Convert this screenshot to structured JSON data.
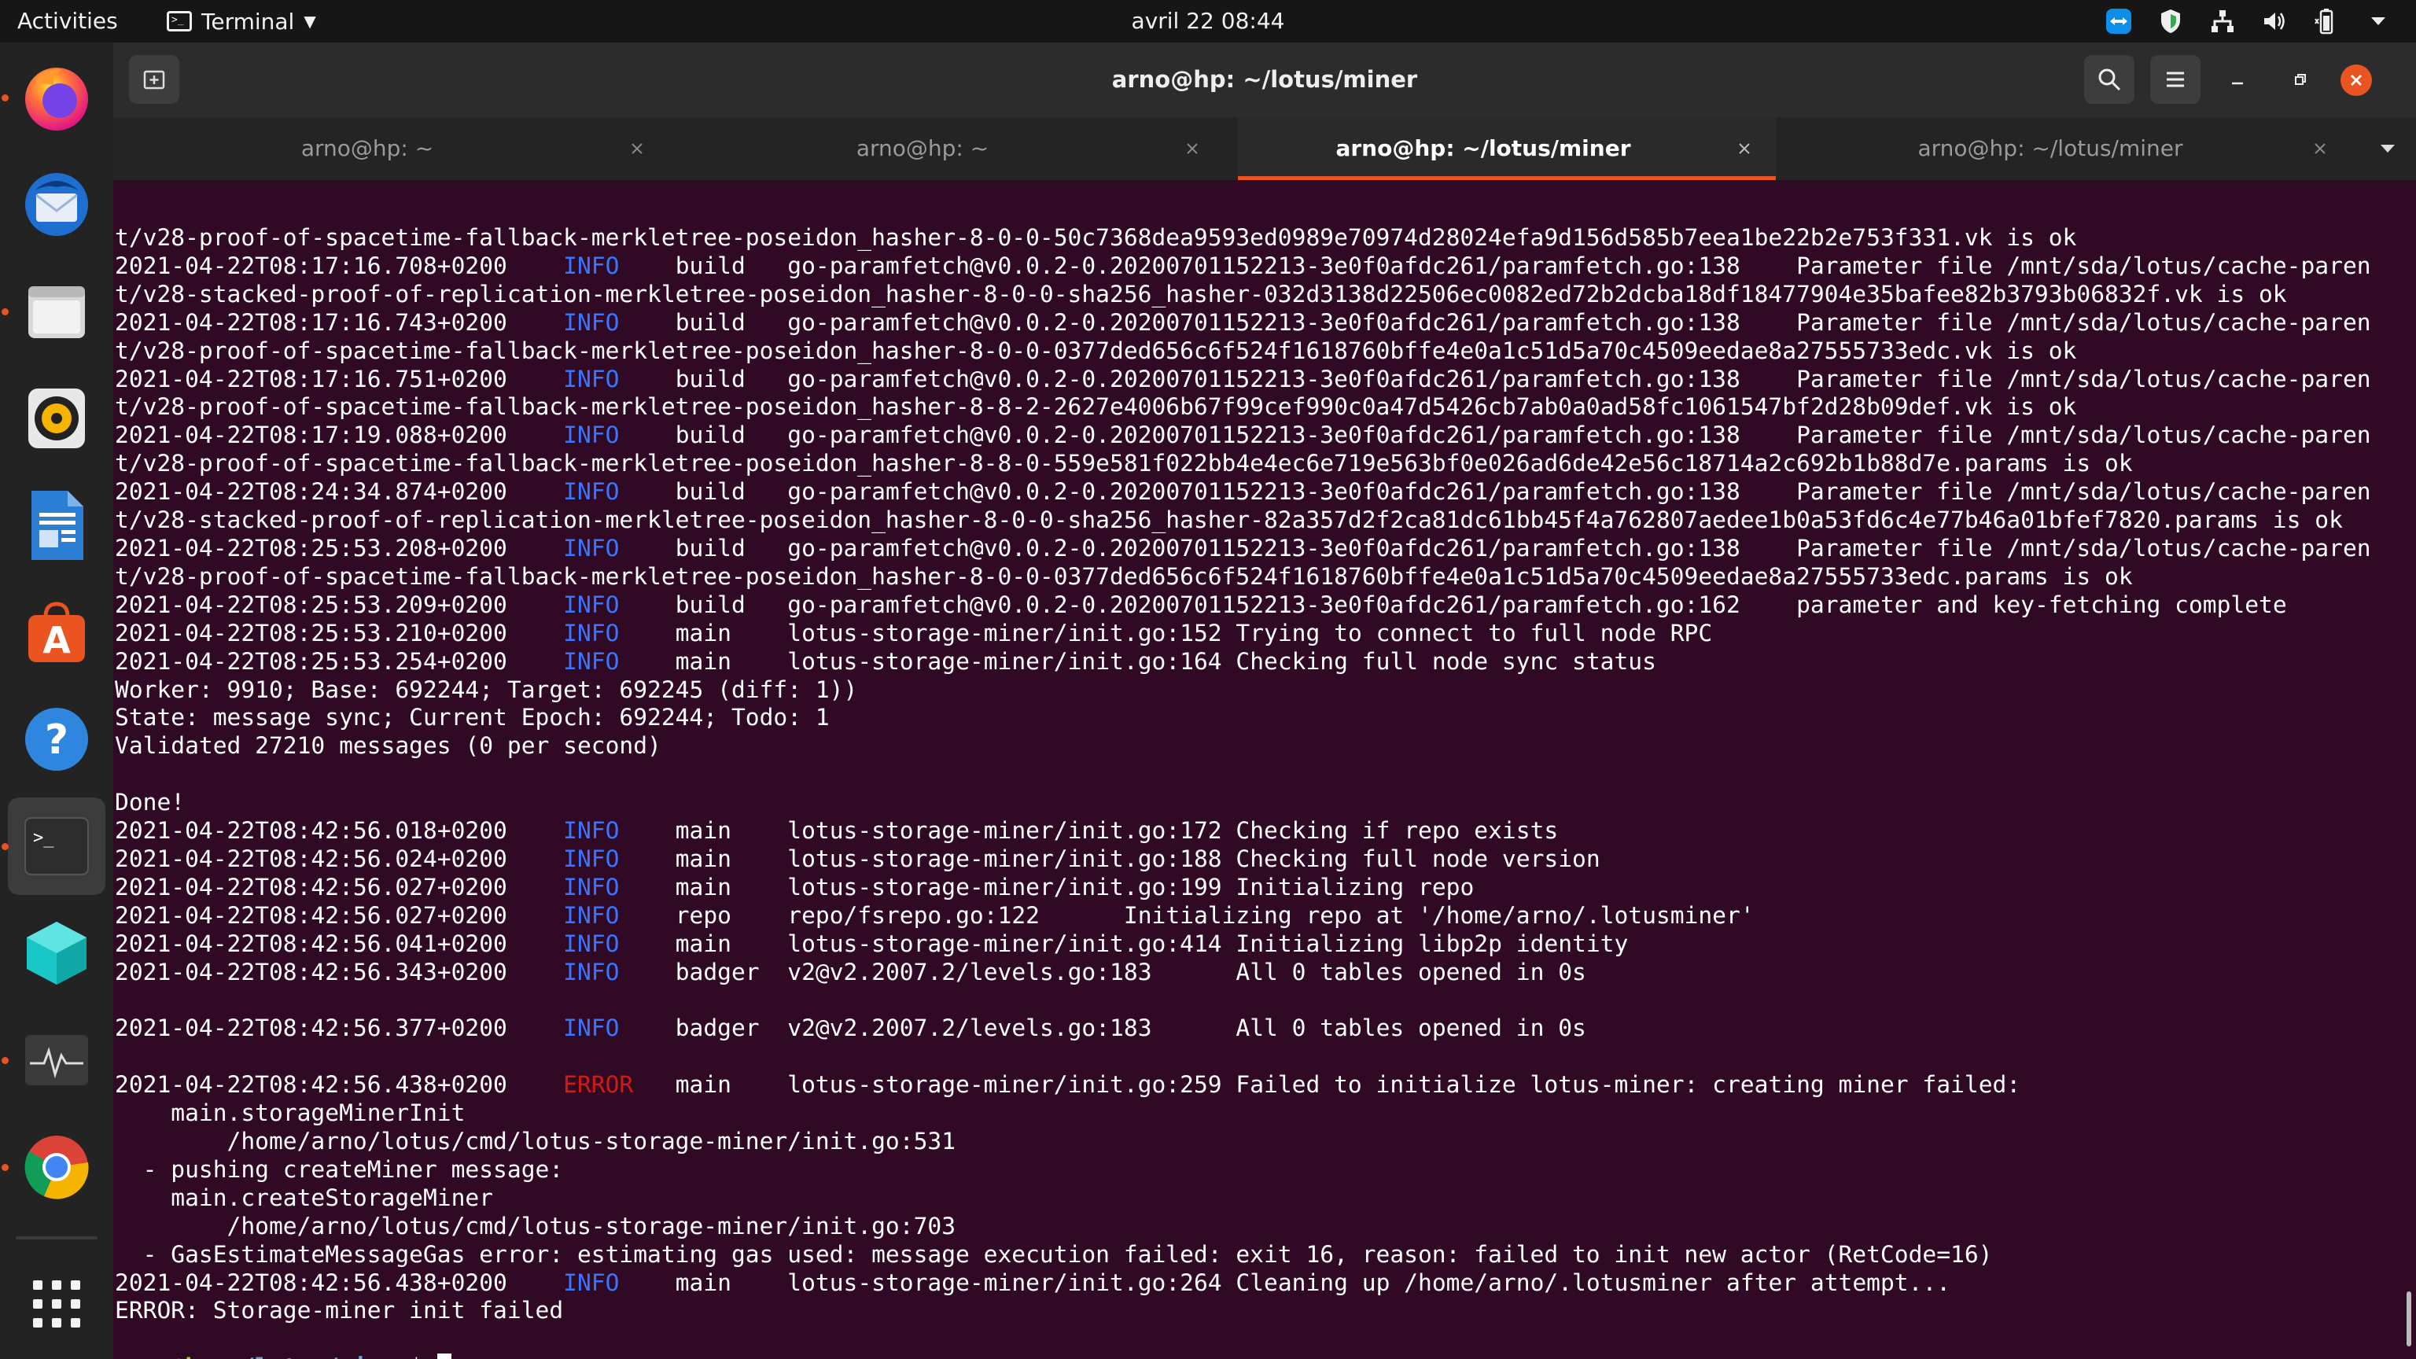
{
  "topbar": {
    "activities": "Activities",
    "app_name": "Terminal",
    "clock": "avril 22  08:44"
  },
  "dock": {
    "apps": [
      {
        "name": "firefox",
        "running": true
      },
      {
        "name": "thunderbird",
        "running": false
      },
      {
        "name": "files",
        "running": true
      },
      {
        "name": "rhythmbox",
        "running": false
      },
      {
        "name": "libreoffice-writer",
        "running": false
      },
      {
        "name": "ubuntu-software",
        "running": false
      },
      {
        "name": "help",
        "running": false
      },
      {
        "name": "terminal",
        "running": true,
        "active": true
      },
      {
        "name": "3d-cube-app",
        "running": false
      },
      {
        "name": "system-monitor",
        "running": true
      },
      {
        "name": "chrome",
        "running": true
      }
    ]
  },
  "window": {
    "title": "arno@hp: ~/lotus/miner",
    "tabs": [
      {
        "label": "arno@hp: ~",
        "active": false
      },
      {
        "label": "arno@hp: ~",
        "active": false
      },
      {
        "label": "arno@hp: ~/lotus/miner",
        "active": true
      },
      {
        "label": "arno@hp: ~/lotus/miner",
        "active": false
      }
    ]
  },
  "colors": {
    "accent": "#e95420",
    "info": "#3a74ff",
    "error": "#d11a14",
    "prompt_user": "#8ae234",
    "prompt_path": "#729fcf",
    "background": "#300a24"
  },
  "terminal": {
    "lines": [
      {
        "text": "t/v28-proof-of-spacetime-fallback-merkletree-poseidon_hasher-8-0-0-50c7368dea9593ed0989e70974d28024efa9d156d585b7eea1be22b2e753f331.vk is ok"
      },
      {
        "ts": "2021-04-22T08:17:16.708+0200",
        "level": "INFO",
        "module": "build ",
        "msg": "go-paramfetch@v0.0.2-0.20200701152213-3e0f0afdc261/paramfetch.go:138    Parameter file /mnt/sda/lotus/cache-paren"
      },
      {
        "text": "t/v28-stacked-proof-of-replication-merkletree-poseidon_hasher-8-0-0-sha256_hasher-032d3138d22506ec0082ed72b2dcba18df18477904e35bafee82b3793b06832f.vk is ok"
      },
      {
        "ts": "2021-04-22T08:17:16.743+0200",
        "level": "INFO",
        "module": "build ",
        "msg": "go-paramfetch@v0.0.2-0.20200701152213-3e0f0afdc261/paramfetch.go:138    Parameter file /mnt/sda/lotus/cache-paren"
      },
      {
        "text": "t/v28-proof-of-spacetime-fallback-merkletree-poseidon_hasher-8-0-0-0377ded656c6f524f1618760bffe4e0a1c51d5a70c4509eedae8a27555733edc.vk is ok"
      },
      {
        "ts": "2021-04-22T08:17:16.751+0200",
        "level": "INFO",
        "module": "build ",
        "msg": "go-paramfetch@v0.0.2-0.20200701152213-3e0f0afdc261/paramfetch.go:138    Parameter file /mnt/sda/lotus/cache-paren"
      },
      {
        "text": "t/v28-proof-of-spacetime-fallback-merkletree-poseidon_hasher-8-8-2-2627e4006b67f99cef990c0a47d5426cb7ab0a0ad58fc1061547bf2d28b09def.vk is ok"
      },
      {
        "ts": "2021-04-22T08:17:19.088+0200",
        "level": "INFO",
        "module": "build ",
        "msg": "go-paramfetch@v0.0.2-0.20200701152213-3e0f0afdc261/paramfetch.go:138    Parameter file /mnt/sda/lotus/cache-paren"
      },
      {
        "text": "t/v28-proof-of-spacetime-fallback-merkletree-poseidon_hasher-8-8-0-559e581f022bb4e4ec6e719e563bf0e026ad6de42e56c18714a2c692b1b88d7e.params is ok"
      },
      {
        "ts": "2021-04-22T08:24:34.874+0200",
        "level": "INFO",
        "module": "build ",
        "msg": "go-paramfetch@v0.0.2-0.20200701152213-3e0f0afdc261/paramfetch.go:138    Parameter file /mnt/sda/lotus/cache-paren"
      },
      {
        "text": "t/v28-stacked-proof-of-replication-merkletree-poseidon_hasher-8-0-0-sha256_hasher-82a357d2f2ca81dc61bb45f4a762807aedee1b0a53fd6c4e77b46a01bfef7820.params is ok"
      },
      {
        "ts": "2021-04-22T08:25:53.208+0200",
        "level": "INFO",
        "module": "build ",
        "msg": "go-paramfetch@v0.0.2-0.20200701152213-3e0f0afdc261/paramfetch.go:138    Parameter file /mnt/sda/lotus/cache-paren"
      },
      {
        "text": "t/v28-proof-of-spacetime-fallback-merkletree-poseidon_hasher-8-0-0-0377ded656c6f524f1618760bffe4e0a1c51d5a70c4509eedae8a27555733edc.params is ok"
      },
      {
        "ts": "2021-04-22T08:25:53.209+0200",
        "level": "INFO",
        "module": "build ",
        "msg": "go-paramfetch@v0.0.2-0.20200701152213-3e0f0afdc261/paramfetch.go:162    parameter and key-fetching complete"
      },
      {
        "ts": "2021-04-22T08:25:53.210+0200",
        "level": "INFO",
        "module": "main  ",
        "msg": "lotus-storage-miner/init.go:152 Trying to connect to full node RPC"
      },
      {
        "ts": "2021-04-22T08:25:53.254+0200",
        "level": "INFO",
        "module": "main  ",
        "msg": "lotus-storage-miner/init.go:164 Checking full node sync status"
      },
      {
        "text": "Worker: 9910; Base: 692244; Target: 692245 (diff: 1))"
      },
      {
        "text": "State: message sync; Current Epoch: 692244; Todo: 1"
      },
      {
        "text": "Validated 27210 messages (0 per second)"
      },
      {
        "text": ""
      },
      {
        "text": "Done!"
      },
      {
        "ts": "2021-04-22T08:42:56.018+0200",
        "level": "INFO",
        "module": "main  ",
        "msg": "lotus-storage-miner/init.go:172 Checking if repo exists"
      },
      {
        "ts": "2021-04-22T08:42:56.024+0200",
        "level": "INFO",
        "module": "main  ",
        "msg": "lotus-storage-miner/init.go:188 Checking full node version"
      },
      {
        "ts": "2021-04-22T08:42:56.027+0200",
        "level": "INFO",
        "module": "main  ",
        "msg": "lotus-storage-miner/init.go:199 Initializing repo"
      },
      {
        "ts": "2021-04-22T08:42:56.027+0200",
        "level": "INFO",
        "module": "repo  ",
        "msg": "repo/fsrepo.go:122      Initializing repo at '/home/arno/.lotusminer'"
      },
      {
        "ts": "2021-04-22T08:42:56.041+0200",
        "level": "INFO",
        "module": "main  ",
        "msg": "lotus-storage-miner/init.go:414 Initializing libp2p identity"
      },
      {
        "ts": "2021-04-22T08:42:56.343+0200",
        "level": "INFO",
        "module": "badger",
        "msg": "v2@v2.2007.2/levels.go:183      All 0 tables opened in 0s"
      },
      {
        "text": ""
      },
      {
        "ts": "2021-04-22T08:42:56.377+0200",
        "level": "INFO",
        "module": "badger",
        "msg": "v2@v2.2007.2/levels.go:183      All 0 tables opened in 0s"
      },
      {
        "text": ""
      },
      {
        "ts": "2021-04-22T08:42:56.438+0200",
        "level": "ERROR",
        "module": "main  ",
        "msg": "lotus-storage-miner/init.go:259 Failed to initialize lotus-miner: creating miner failed:"
      },
      {
        "text": "    main.storageMinerInit"
      },
      {
        "text": "        /home/arno/lotus/cmd/lotus-storage-miner/init.go:531"
      },
      {
        "text": "  - pushing createMiner message:"
      },
      {
        "text": "    main.createStorageMiner"
      },
      {
        "text": "        /home/arno/lotus/cmd/lotus-storage-miner/init.go:703"
      },
      {
        "text": "  - GasEstimateMessageGas error: estimating gas used: message execution failed: exit 16, reason: failed to init new actor (RetCode=16)"
      },
      {
        "ts": "2021-04-22T08:42:56.438+0200",
        "level": "INFO",
        "module": "main  ",
        "msg": "lotus-storage-miner/init.go:264 Cleaning up /home/arno/.lotusminer after attempt..."
      },
      {
        "text": "ERROR: Storage-miner init failed"
      },
      {
        "text": ""
      }
    ],
    "prompt": {
      "user": "arno@hp",
      "sep": ":",
      "path": "~/lotus/miner",
      "symbol": "$ "
    }
  }
}
